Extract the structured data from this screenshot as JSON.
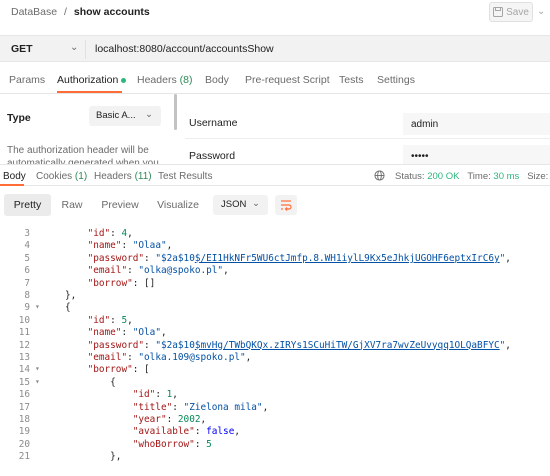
{
  "header": {
    "breadcrumb_root": "DataBase",
    "breadcrumb_sep": "/",
    "breadcrumb_current": "show accounts",
    "save_label": "Save"
  },
  "request": {
    "method": "GET",
    "url": "localhost:8080/account/accountsShow"
  },
  "request_tabs": [
    {
      "label": "Params"
    },
    {
      "label": "Authorization"
    },
    {
      "label": "Headers",
      "count": "(8)"
    },
    {
      "label": "Body"
    },
    {
      "label": "Pre-request Script"
    },
    {
      "label": "Tests"
    },
    {
      "label": "Settings"
    }
  ],
  "auth": {
    "type_label": "Type",
    "type_value": "Basic A...",
    "help_text": "The authorization header will be automatically generated when you",
    "username_label": "Username",
    "username_value": "admin",
    "password_label": "Password",
    "password_value": "•••••"
  },
  "response_tabs": [
    {
      "label": "Body"
    },
    {
      "label": "Cookies",
      "count": "(1)"
    },
    {
      "label": "Headers",
      "count": "(11)"
    },
    {
      "label": "Test Results"
    }
  ],
  "response_status": {
    "status_label": "Status:",
    "status_value": "200 OK",
    "time_label": "Time:",
    "time_value": "30 ms",
    "size_label": "Size:",
    "size_value": "90"
  },
  "view_modes": [
    "Pretty",
    "Raw",
    "Preview",
    "Visualize"
  ],
  "format": "JSON",
  "code_lines": [
    {
      "num": "3",
      "indent": "        ",
      "tokens": [
        {
          "k": "\"id\""
        },
        {
          "p": ": "
        },
        {
          "n": "4"
        },
        {
          "p": ","
        }
      ]
    },
    {
      "num": "4",
      "indent": "        ",
      "tokens": [
        {
          "k": "\"name\""
        },
        {
          "p": ": "
        },
        {
          "s": "\"Olaa\""
        },
        {
          "p": ","
        }
      ]
    },
    {
      "num": "5",
      "indent": "        ",
      "tokens": [
        {
          "k": "\"password\""
        },
        {
          "p": ": "
        },
        {
          "s": "\"$2a$10"
        },
        {
          "l": "$/EI1HkNFr5WU6ctJmfp.8.WH1iylL9Kx5eJhkjUGOHF6eptxIrC6y"
        },
        {
          "s": "\""
        },
        {
          "p": ","
        }
      ]
    },
    {
      "num": "6",
      "indent": "        ",
      "tokens": [
        {
          "k": "\"email\""
        },
        {
          "p": ": "
        },
        {
          "s": "\"olka@spoko.pl\""
        },
        {
          "p": ","
        }
      ]
    },
    {
      "num": "7",
      "indent": "        ",
      "tokens": [
        {
          "k": "\"borrow\""
        },
        {
          "p": ": []"
        }
      ]
    },
    {
      "num": "8",
      "indent": "    ",
      "tokens": [
        {
          "p": "},"
        }
      ]
    },
    {
      "num": "9",
      "indent": "    ",
      "tokens": [
        {
          "p": "{"
        }
      ],
      "fold": true
    },
    {
      "num": "10",
      "indent": "        ",
      "tokens": [
        {
          "k": "\"id\""
        },
        {
          "p": ": "
        },
        {
          "n": "5"
        },
        {
          "p": ","
        }
      ]
    },
    {
      "num": "11",
      "indent": "        ",
      "tokens": [
        {
          "k": "\"name\""
        },
        {
          "p": ": "
        },
        {
          "s": "\"Ola\""
        },
        {
          "p": ","
        }
      ]
    },
    {
      "num": "12",
      "indent": "        ",
      "tokens": [
        {
          "k": "\"password\""
        },
        {
          "p": ": "
        },
        {
          "s": "\"$2a$10"
        },
        {
          "l": "$mvHg/TWbQKQx.zIRYs1SCuHiTW/GjXV7ra7wvZeUvyqq1OLQaBFYC"
        },
        {
          "s": "\""
        },
        {
          "p": ","
        }
      ]
    },
    {
      "num": "13",
      "indent": "        ",
      "tokens": [
        {
          "k": "\"email\""
        },
        {
          "p": ": "
        },
        {
          "s": "\"olka.109@spoko.pl\""
        },
        {
          "p": ","
        }
      ]
    },
    {
      "num": "14",
      "indent": "        ",
      "tokens": [
        {
          "k": "\"borrow\""
        },
        {
          "p": ": ["
        }
      ],
      "fold": true
    },
    {
      "num": "15",
      "indent": "            ",
      "tokens": [
        {
          "p": "{"
        }
      ],
      "fold": true
    },
    {
      "num": "16",
      "indent": "                ",
      "tokens": [
        {
          "k": "\"id\""
        },
        {
          "p": ": "
        },
        {
          "n": "1"
        },
        {
          "p": ","
        }
      ]
    },
    {
      "num": "17",
      "indent": "                ",
      "tokens": [
        {
          "k": "\"title\""
        },
        {
          "p": ": "
        },
        {
          "s": "\"Zielona mila\""
        },
        {
          "p": ","
        }
      ]
    },
    {
      "num": "18",
      "indent": "                ",
      "tokens": [
        {
          "k": "\"year\""
        },
        {
          "p": ": "
        },
        {
          "n": "2002"
        },
        {
          "p": ","
        }
      ]
    },
    {
      "num": "19",
      "indent": "                ",
      "tokens": [
        {
          "k": "\"available\""
        },
        {
          "p": ": "
        },
        {
          "b": "false"
        },
        {
          "p": ","
        }
      ]
    },
    {
      "num": "20",
      "indent": "                ",
      "tokens": [
        {
          "k": "\"whoBorrow\""
        },
        {
          "p": ": "
        },
        {
          "n": "5"
        }
      ]
    },
    {
      "num": "21",
      "indent": "            ",
      "tokens": [
        {
          "p": "},"
        }
      ]
    }
  ],
  "colors": {
    "accent": "#ff6c37",
    "status_ok": "#2eb67d",
    "json_key": "#a31515",
    "json_string": "#0451a5",
    "json_number": "#098658",
    "json_boolean": "#0000ff"
  },
  "icons": [
    "save-icon",
    "chevron-down-icon",
    "globe-icon",
    "wrap-lines-icon",
    "fold-arrow-icon"
  ]
}
